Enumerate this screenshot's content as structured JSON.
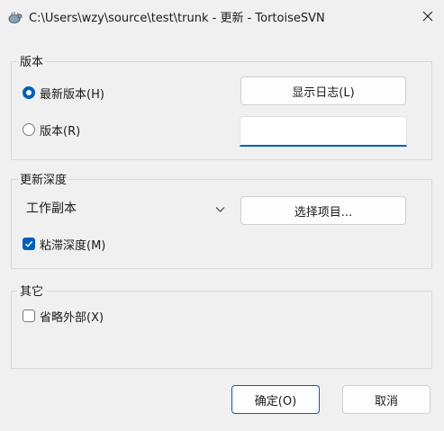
{
  "window": {
    "title": "C:\\Users\\wzy\\source\\test\\trunk - 更新 - TortoiseSVN",
    "app_icon": "tortoise-icon",
    "close_icon": "close-icon"
  },
  "revision_group": {
    "label": "版本",
    "head_option": {
      "label": "最新版本(H)",
      "selected": true
    },
    "revision_option": {
      "label": "版本(R)",
      "selected": false
    },
    "show_log_button": "显示日志(L)",
    "revision_input": {
      "value": "",
      "placeholder": ""
    }
  },
  "depth_group": {
    "label": "更新深度",
    "depth_select": {
      "value": "工作副本"
    },
    "choose_items_button": "选择项目...",
    "sticky_depth": {
      "label": "粘滞深度(M)",
      "checked": true
    }
  },
  "other_group": {
    "label": "其它",
    "omit_externals": {
      "label": "省略外部(X)",
      "checked": false
    }
  },
  "buttons": {
    "ok": "确定(O)",
    "cancel": "取消"
  },
  "colors": {
    "accent": "#005fb8",
    "background": "#f0f0f0"
  }
}
